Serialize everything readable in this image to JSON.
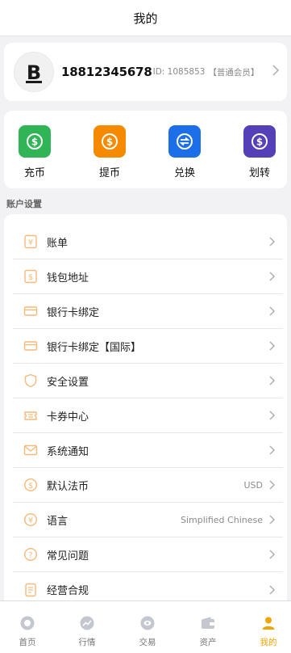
{
  "header": {
    "title": "我的"
  },
  "profile": {
    "phone": "18812345678",
    "uid": "ID: 1085853",
    "member_level": "【普通会员】",
    "avatar_letter": "B"
  },
  "actions": [
    {
      "label": "充币",
      "color": "#2fb556",
      "icon": "dollar-circle-icon"
    },
    {
      "label": "提币",
      "color": "#f58a00",
      "icon": "dollar-circle-icon"
    },
    {
      "label": "兑换",
      "color": "#1c6fe8",
      "icon": "exchange-icon"
    },
    {
      "label": "划转",
      "color": "#5640b8",
      "icon": "dollar-circle-icon"
    }
  ],
  "section_title": "账户设置",
  "menu": [
    {
      "label": "账单",
      "value": "",
      "icon": "bill-icon"
    },
    {
      "label": "钱包地址",
      "value": "",
      "icon": "wallet-address-icon"
    },
    {
      "label": "银行卡绑定",
      "value": "",
      "icon": "bank-card-icon"
    },
    {
      "label": "银行卡绑定【国际】",
      "value": "",
      "icon": "bank-card-icon"
    },
    {
      "label": "安全设置",
      "value": "",
      "icon": "shield-icon"
    },
    {
      "label": "卡券中心",
      "value": "",
      "icon": "coupon-icon"
    },
    {
      "label": "系统通知",
      "value": "",
      "icon": "mail-icon"
    },
    {
      "label": "默认法币",
      "value": "USD",
      "icon": "currency-icon"
    },
    {
      "label": "语言",
      "value": "Simplified Chinese",
      "icon": "language-icon"
    },
    {
      "label": "常见问题",
      "value": "",
      "icon": "question-icon"
    },
    {
      "label": "经营合规",
      "value": "",
      "icon": "compliance-icon"
    }
  ],
  "nav": [
    {
      "label": "首页",
      "active": false,
      "icon": "home-icon"
    },
    {
      "label": "行情",
      "active": false,
      "icon": "market-icon"
    },
    {
      "label": "交易",
      "active": false,
      "icon": "trade-icon"
    },
    {
      "label": "资产",
      "active": false,
      "icon": "wallet-icon"
    },
    {
      "label": "我的",
      "active": true,
      "icon": "user-icon"
    }
  ],
  "colors": {
    "accent": "#f0a400",
    "menu_icon": "#f5b97a",
    "nav_icon": "#b8bcc6"
  }
}
